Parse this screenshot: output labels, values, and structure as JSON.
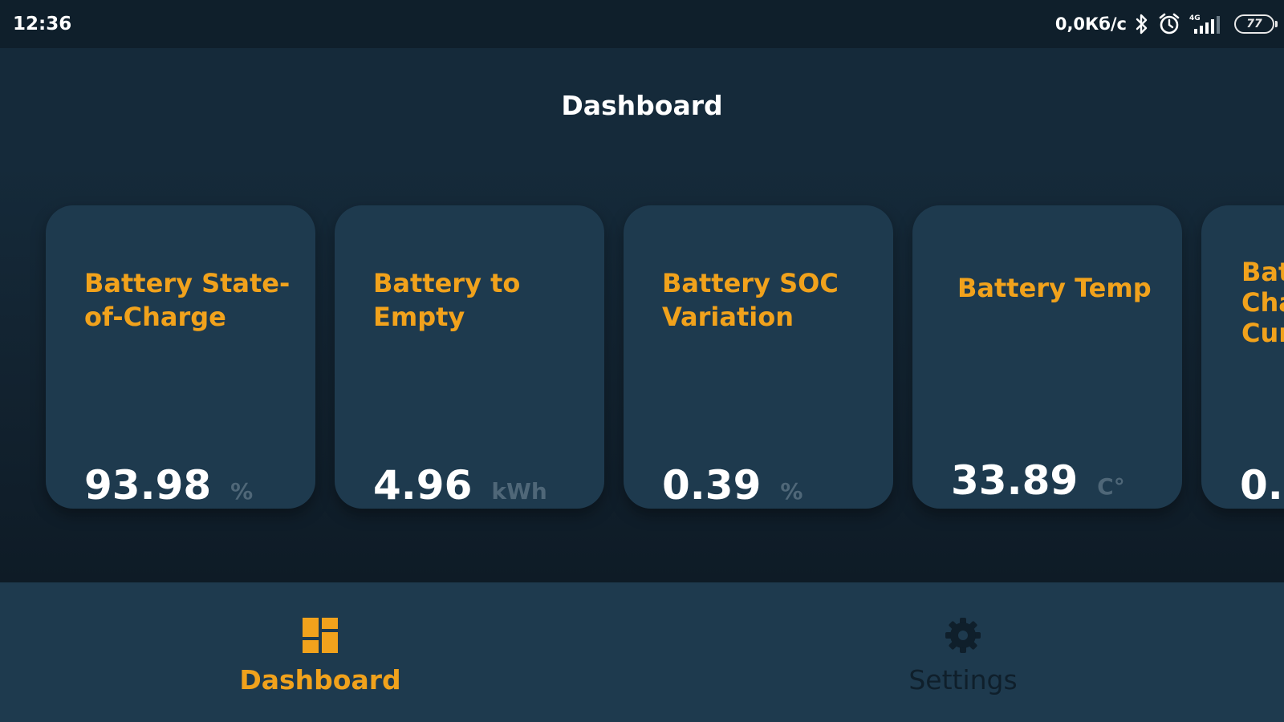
{
  "status_bar": {
    "time": "12:36",
    "net_speed": "0,0Кб/с",
    "battery_level": "77",
    "icons": [
      "bluetooth-icon",
      "alarm-icon",
      "signal-4g-icon",
      "battery-icon"
    ]
  },
  "header": {
    "title": "Dashboard"
  },
  "cards": [
    {
      "title": "Battery State-\nof-Charge",
      "value": "93.98",
      "unit": "%"
    },
    {
      "title": "Battery to\nEmpty",
      "value": "4.96",
      "unit": "kWh"
    },
    {
      "title": "Battery SOC\nVariation",
      "value": "0.39",
      "unit": "%"
    },
    {
      "title": "Battery Temp",
      "value": "33.89",
      "unit": "C°"
    },
    {
      "title": "Bat\nCha\nCur",
      "value": "0.("
    }
  ],
  "bottom_nav": {
    "items": [
      {
        "label": "Dashboard",
        "icon": "dashboard-icon",
        "active": true
      },
      {
        "label": "Settings",
        "icon": "gear-icon",
        "active": false
      }
    ]
  },
  "colors": {
    "background": "#152a3a",
    "status_bar": "#0f1f2b",
    "card": "#1e3a4e",
    "accent": "#f1a21c",
    "value_text": "#ffffff",
    "unit_text": "#4f6778",
    "inactive_nav": "#0f1f2b"
  }
}
